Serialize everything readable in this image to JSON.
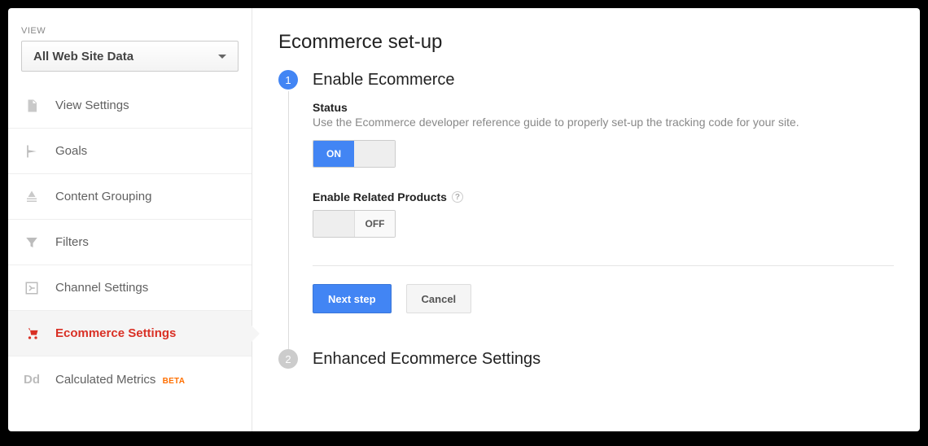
{
  "sidebar": {
    "view_label": "VIEW",
    "selected_view": "All Web Site Data",
    "items": [
      {
        "label": "View Settings"
      },
      {
        "label": "Goals"
      },
      {
        "label": "Content Grouping"
      },
      {
        "label": "Filters"
      },
      {
        "label": "Channel Settings"
      },
      {
        "label": "Ecommerce Settings"
      },
      {
        "label": "Calculated Metrics",
        "badge": "BETA"
      }
    ]
  },
  "main": {
    "title": "Ecommerce set-up",
    "step1": {
      "num": "1",
      "title": "Enable Ecommerce",
      "status_label": "Status",
      "help": "Use the Ecommerce developer reference guide to properly set-up the tracking code for your site.",
      "toggle_on": "ON",
      "related_label": "Enable Related Products",
      "help_glyph": "?",
      "toggle_off": "OFF",
      "next_btn": "Next step",
      "cancel_btn": "Cancel"
    },
    "step2": {
      "num": "2",
      "title": "Enhanced Ecommerce Settings"
    }
  }
}
